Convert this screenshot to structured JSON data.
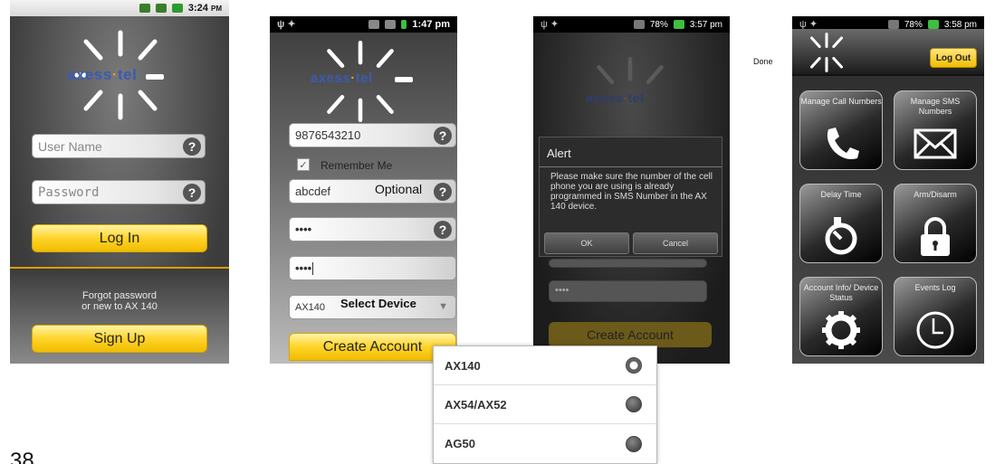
{
  "brand": {
    "logo_text_left": "axess",
    "logo_text_right": "tel"
  },
  "screen1": {
    "status_time": "3:24",
    "status_ampm": "PM",
    "username_placeholder": "User Name",
    "password_placeholder": "Password",
    "login_label": "Log In",
    "forgot_line1": "Forgot password",
    "forgot_line2": "or new to AX 140",
    "signup_label": "Sign Up"
  },
  "screen2": {
    "status_time": "1:47 pm",
    "phone_value": "9876543210",
    "remember_label": "Remember Me",
    "remember_checked": true,
    "name_value": "abcdef",
    "optional_note": "Optional",
    "password_mask": "••••",
    "confirm_mask": "••••",
    "select_value": "AX140",
    "select_hint": "Select Device",
    "create_label": "Create Account"
  },
  "screen3": {
    "status_battery": "78%",
    "status_time": "3:57 pm",
    "alert_title": "Alert",
    "alert_message": "Please make sure the number of the cell phone you are using is already programmed in SMS Number in the AX 140 device.",
    "ok_label": "OK",
    "cancel_label": "Cancel",
    "password_mask": "••••",
    "create_label": "Create Account"
  },
  "done_label": "Done",
  "screen4": {
    "status_battery": "78%",
    "status_time": "3:58 pm",
    "logout_label": "Log Out",
    "tiles": [
      {
        "label": "Manage Call Numbers",
        "icon": "phone-icon"
      },
      {
        "label": "Manage SMS Numbers",
        "icon": "envelope-icon"
      },
      {
        "label": "Delay Time",
        "icon": "timer-icon"
      },
      {
        "label": "Arm/Disarm",
        "icon": "lock-icon"
      },
      {
        "label": "Account Info/ Device Status",
        "icon": "gear-icon"
      },
      {
        "label": "Events Log",
        "icon": "clock-icon"
      }
    ]
  },
  "device_options": [
    {
      "label": "AX140",
      "selected": true
    },
    {
      "label": "AX54/AX52",
      "selected": false
    },
    {
      "label": "AG50",
      "selected": false
    }
  ],
  "page_number": "38",
  "colors": {
    "accent_yellow": "#ffd429",
    "brand_blue": "#3a5bb2"
  }
}
